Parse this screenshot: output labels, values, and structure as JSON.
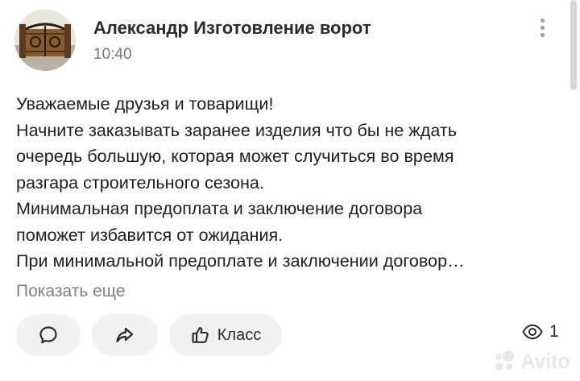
{
  "post": {
    "author": "Александр Изготовление ворот",
    "time": "10:40",
    "text_lines": [
      "Уважаемые друзья и товарищи!",
      "Начните заказывать заранее изделия что бы не ждать",
      "очередь большую, которая может случиться во время",
      "разгара строительного сезона.",
      "Минимальная предоплата и заключение договора",
      "поможет избавится от ожидания.",
      "При минимальной предоплате и заключении договор…"
    ],
    "show_more_label": "Показать еще"
  },
  "actions": {
    "comment_icon": "speech-bubble-icon",
    "share_icon": "share-arrow-icon",
    "like_icon": "thumbs-up-icon",
    "like_label": "Класс"
  },
  "views": {
    "icon": "eye-icon",
    "count": "1"
  },
  "watermark": {
    "text": "Avito",
    "icon": "avito-dots-icon"
  },
  "colors": {
    "button_bg": "#f0f1f3",
    "secondary_text": "#7c8189",
    "primary_text": "#202020"
  }
}
